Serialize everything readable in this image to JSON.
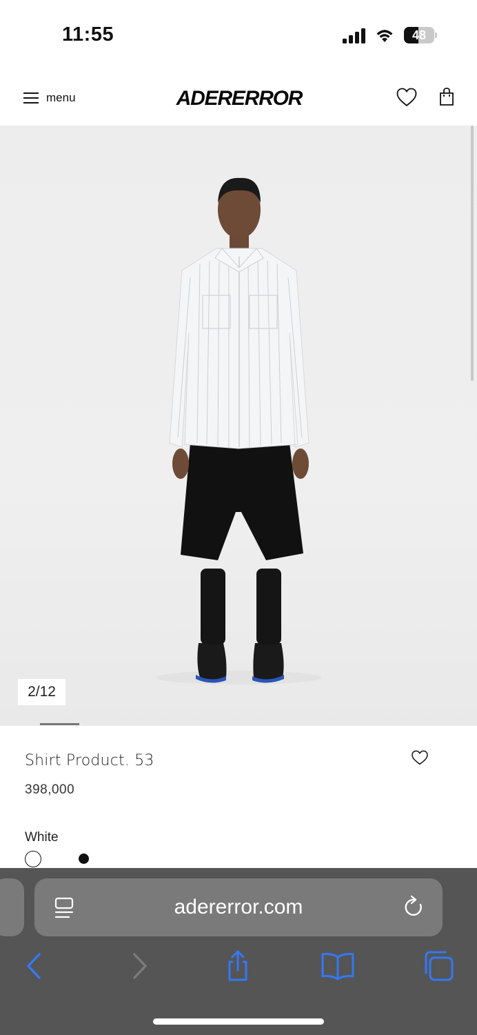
{
  "status_bar": {
    "time": "11:55",
    "battery_level": "48",
    "battery_percent": 48
  },
  "header": {
    "menu_label": "menu",
    "brand": "ADERERROR",
    "icons": [
      "hamburger-icon",
      "heart-icon",
      "shopping-bag-icon"
    ]
  },
  "gallery": {
    "counter": "2/12",
    "current": 2,
    "total": 12
  },
  "product": {
    "title": "Shirt Product. 53",
    "price": "398,000",
    "color_label": "White",
    "colors": [
      "#ffffff",
      "#111111"
    ],
    "selected_color_index": 0
  },
  "browser": {
    "url": "adererror.com",
    "icons": [
      "page-menu-icon",
      "reload-icon",
      "back-icon",
      "forward-icon",
      "share-icon",
      "bookmarks-icon",
      "tabs-icon"
    ],
    "accent": "#3478f6"
  }
}
